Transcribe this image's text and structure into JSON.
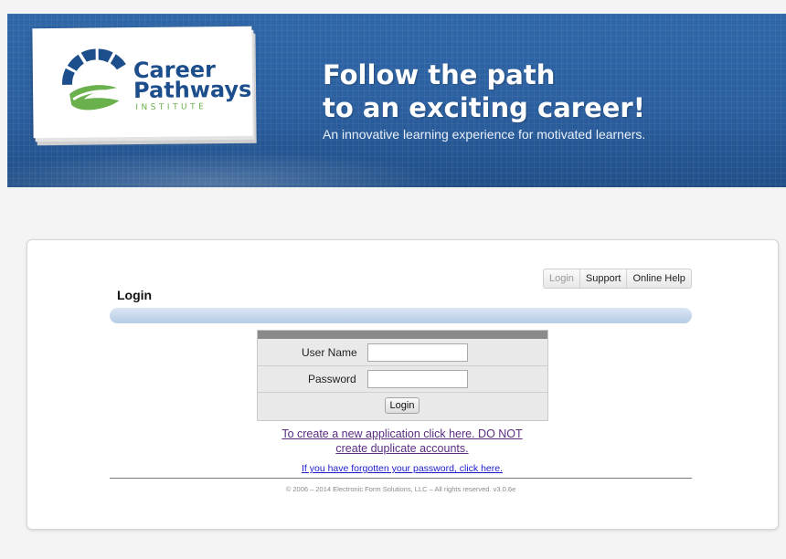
{
  "banner": {
    "logo": {
      "line1": "Career",
      "line2": "Pathways",
      "line3": "INSTITUTE",
      "colors": {
        "arc": "#1d4e8c",
        "swirl": "#6ab04c"
      }
    },
    "headline_line1": "Follow the path",
    "headline_line2": "to an exciting career!",
    "tagline": "An innovative learning experience for motivated learners."
  },
  "topnav": {
    "items": [
      "Login",
      "Support",
      "Online Help"
    ],
    "current": "Login"
  },
  "login": {
    "title": "Login",
    "username_label": "User Name",
    "username_value": "",
    "password_label": "Password",
    "password_value": "",
    "submit_label": "Login"
  },
  "links": {
    "create_line1": "To create a new application click here.  DO NOT",
    "create_line2": "create duplicate accounts.",
    "forgot": "If you have forgotten your password, click here."
  },
  "footer": {
    "copyright": "© 2006 – 2014 Electronic Form Solutions, LLC  –  All rights reserved.  v3.0.6e"
  },
  "colors": {
    "banner": "#2b5f9f",
    "link_visited": "#5a2d82",
    "link": "#1b1bcc"
  }
}
